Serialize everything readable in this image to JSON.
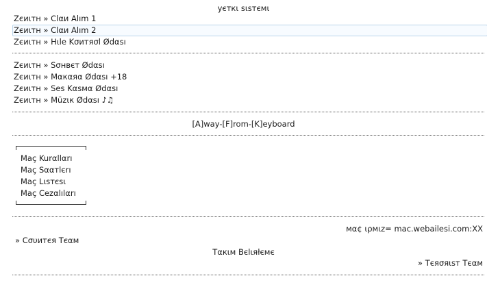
{
  "header": {
    "title": "уєткι sιsтємι"
  },
  "channels_group1": [
    {
      "label": "Ζєиιтн » Clαи Alım 1"
    },
    {
      "label": "Ζєиιтн » Clαи Alım 2"
    },
    {
      "label": "Ζєиιтн » Hιle Kσитяσl Ødαsı"
    }
  ],
  "channels_group2": [
    {
      "label": "Ζєиιтн » Sσнвєт Ødαsı"
    },
    {
      "label": "Ζєиιтн » Mαкαяα Ødαsı +18"
    },
    {
      "label": "Ζєиιтн » Ses Kαsмα Ødαsı"
    },
    {
      "label": "Ζєиιтн » Müzιк Ødαsı ♪♫"
    }
  ],
  "afk": {
    "label": "[A]way-[F]rom-[K]eyboard"
  },
  "menu": {
    "items": [
      {
        "label": "Maç Kurαllαrı"
      },
      {
        "label": "Maç Sααтlєrı"
      },
      {
        "label": "Maç Lιsтєsι"
      },
      {
        "label": "Maç Cezαlılαrı"
      }
    ]
  },
  "match": {
    "ip_label": "мα¢ ιρмιz= mac.webailesi.com:XX",
    "team_ct": "» Cσυитєя Tєαм",
    "team_select": "Tαкιм Bєlιяłємє",
    "team_t": "» Tєяσяιsт Tєαм"
  },
  "colors": {
    "selection_border": "#b9d4ea",
    "selection_bg": "#f7fbff",
    "text": "#1a1a1a"
  }
}
